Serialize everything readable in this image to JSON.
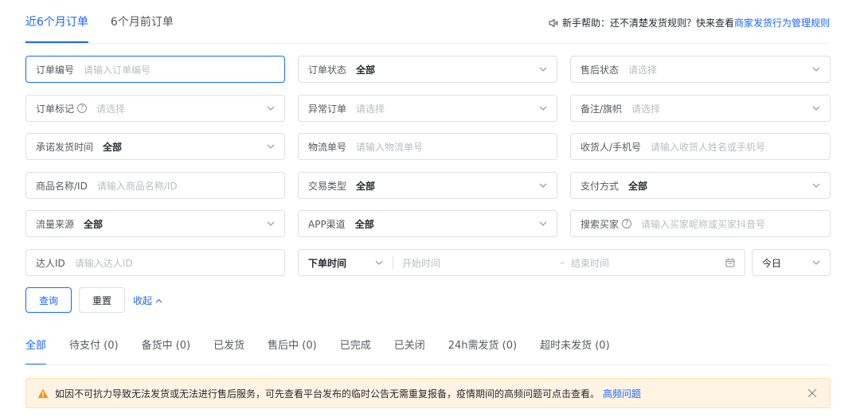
{
  "top_tabs": [
    {
      "label": "近6个月订单",
      "active": true
    },
    {
      "label": "6个月前订单",
      "active": false
    }
  ],
  "help": {
    "text": "新手帮助：还不清楚发货规则？快来查看",
    "link": "商家发货行为管理规则"
  },
  "filters": {
    "order_no": {
      "label": "订单编号",
      "placeholder": "请输入订单编号"
    },
    "order_status": {
      "label": "订单状态",
      "value": "全部"
    },
    "after_sale": {
      "label": "售后状态",
      "placeholder": "请选择"
    },
    "order_mark": {
      "label": "订单标记",
      "placeholder": "请选择"
    },
    "abnormal": {
      "label": "异常订单",
      "placeholder": "请选择"
    },
    "remark_flag": {
      "label": "备注/旗帜",
      "placeholder": "请选择"
    },
    "promise_time": {
      "label": "承诺发货时间",
      "value": "全部"
    },
    "logistics_no": {
      "label": "物流单号",
      "placeholder": "请输入物流单号"
    },
    "receiver": {
      "label": "收货人/手机号",
      "placeholder": "请输入收货人姓名或手机号"
    },
    "product": {
      "label": "商品名称/ID",
      "placeholder": "请输入商品名称/ID"
    },
    "trade_type": {
      "label": "交易类型",
      "value": "全部"
    },
    "pay_method": {
      "label": "支付方式",
      "value": "全部"
    },
    "traffic_source": {
      "label": "流量来源",
      "value": "全部"
    },
    "app_channel": {
      "label": "APP渠道",
      "value": "全部"
    },
    "buyer_search": {
      "label": "搜索买家",
      "placeholder": "请输入买家昵称或买家抖音号"
    },
    "talent_id": {
      "label": "达人ID",
      "placeholder": "请输入达人ID"
    },
    "time": {
      "type": "下单时间",
      "start": "开始时间",
      "dash": "–",
      "end": "结束时间"
    },
    "range": {
      "value": "今日"
    }
  },
  "buttons": {
    "query": "查询",
    "reset": "重置",
    "collapse": "收起"
  },
  "status_tabs": [
    {
      "label": "全部",
      "active": true
    },
    {
      "label": "待支付 (0)",
      "active": false
    },
    {
      "label": "备货中 (0)",
      "active": false
    },
    {
      "label": "已发货",
      "active": false
    },
    {
      "label": "售后中 (0)",
      "active": false
    },
    {
      "label": "已完成",
      "active": false
    },
    {
      "label": "已关闭",
      "active": false
    },
    {
      "label": "24h需发货 (0)",
      "active": false
    },
    {
      "label": "超时未发货 (0)",
      "active": false
    }
  ],
  "notice": {
    "text": "如因不可抗力导致无法发货或无法进行售后服务，可先查看平台发布的临时公告无需重复报备，疫情期间的高频问题可点击查看。",
    "link": "高频问题"
  },
  "colors": {
    "accent": "#1966ff",
    "warning": "#ff8b00",
    "notice_bg": "#fff4e3"
  }
}
